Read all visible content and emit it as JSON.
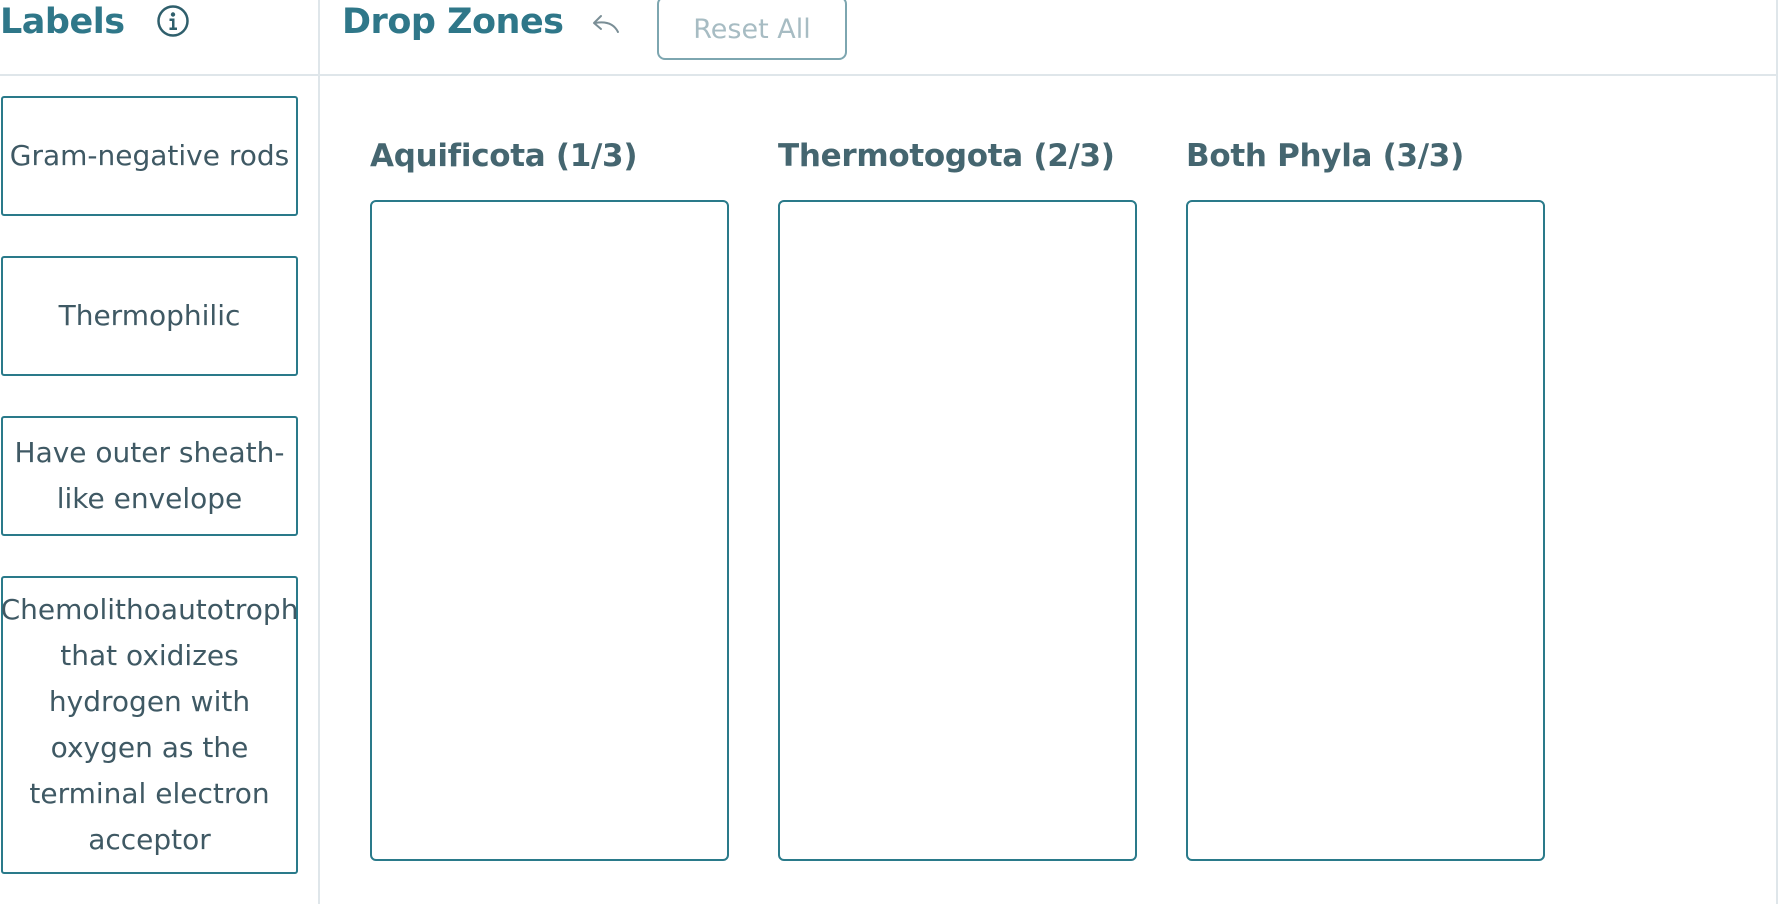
{
  "labels_panel": {
    "title": "Labels",
    "info_icon": "info-circle-icon",
    "cards": [
      {
        "text": "Gram-negative rods"
      },
      {
        "text": "Thermophilic"
      },
      {
        "text": "Have outer sheath-like envelope"
      },
      {
        "text": "Chemolithoautotroph that oxidizes hydrogen with oxygen as the terminal electron acceptor"
      }
    ]
  },
  "zones_panel": {
    "title": "Drop Zones",
    "undo_icon": "undo-arrow-icon",
    "reset_label": "Reset All",
    "zones": [
      {
        "title": "Aquificota (1/3)"
      },
      {
        "title": "Thermotogota (2/3)"
      },
      {
        "title": "Both Phyla (3/3)"
      }
    ]
  },
  "colors": {
    "accent": "#2f7789",
    "border": "#2a7a8a",
    "text": "#3f5964",
    "divider": "#dfe6ea",
    "disabled_text": "#a7bcc3"
  }
}
